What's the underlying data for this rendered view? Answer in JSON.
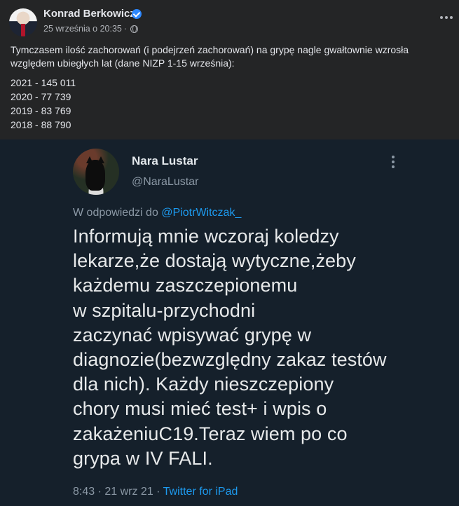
{
  "post": {
    "author": "Konrad Berkowicz",
    "timestamp": "25 września o 20:35",
    "separator": "·",
    "intro": "Tymczasem ilość zachorowań (i podejrzeń zachorowań) na grypę nagle gwałtownie wzrosła względem ubiegłych lat (dane NIZP 1-15 września):",
    "stats": [
      "2021 - 145 011",
      "2020 - 77 739",
      "2019 - 83 769",
      "2018 - 88 790"
    ],
    "icons": {
      "verified": "verified-badge-icon",
      "audience": "globe-icon",
      "menu": "more-options-icon"
    }
  },
  "tweet": {
    "name": "Nara Lustar",
    "handle": "@NaraLustar",
    "reply_prefix": "W odpowiedzi do ",
    "reply_to": "@PiotrWitczak_",
    "body_lines": [
      "Informują mnie wczoraj koledzy",
      "lekarze,że dostają wytyczne,żeby",
      "każdemu zaszczepionemu",
      "w szpitalu-przychodni",
      "zaczynać wpisywać grypę w",
      "diagnozie(bezwzględny zakaz testów",
      "dla nich). Każdy nieszczepiony",
      "chory musi mieć test+ i wpis o",
      "zakażeniuC19.Teraz wiem po co",
      "grypa w IV FALI."
    ],
    "time": "8:43 · 21 wrz 21 · ",
    "source": "Twitter for iPad"
  },
  "colors": {
    "fb_bg": "#242526",
    "tweet_bg": "#15202b",
    "link": "#1d9bf0",
    "verified": "#2d88ff"
  }
}
